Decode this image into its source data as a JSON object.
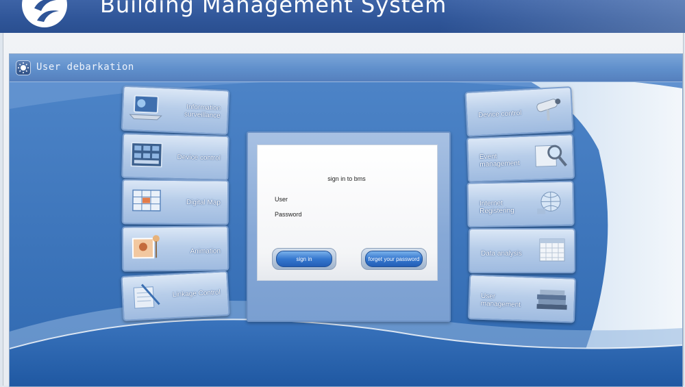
{
  "header": {
    "title": "Building Management System"
  },
  "window": {
    "title": "User debarkation"
  },
  "left_menu": [
    {
      "label": "Information surveillance",
      "icon": "laptop-icon"
    },
    {
      "label": "Device control",
      "icon": "control-panel-icon"
    },
    {
      "label": "Digital Map",
      "icon": "map-icon"
    },
    {
      "label": "Animation",
      "icon": "animation-icon"
    },
    {
      "label": "Linkage Control",
      "icon": "notepad-pen-icon"
    }
  ],
  "right_menu": [
    {
      "label": "Device control",
      "icon": "camera-icon"
    },
    {
      "label": "Event management",
      "icon": "magnifier-document-icon"
    },
    {
      "label": "Internet Registering",
      "icon": "globe-network-icon"
    },
    {
      "label": "Data analysis",
      "icon": "calendar-grid-icon"
    },
    {
      "label": "User management",
      "icon": "book-stack-icon"
    }
  ],
  "login": {
    "heading": "sign in to bms",
    "user_label": "User",
    "password_label": "Password",
    "signin_label": "sign in",
    "forgot_label": "forget your password"
  }
}
